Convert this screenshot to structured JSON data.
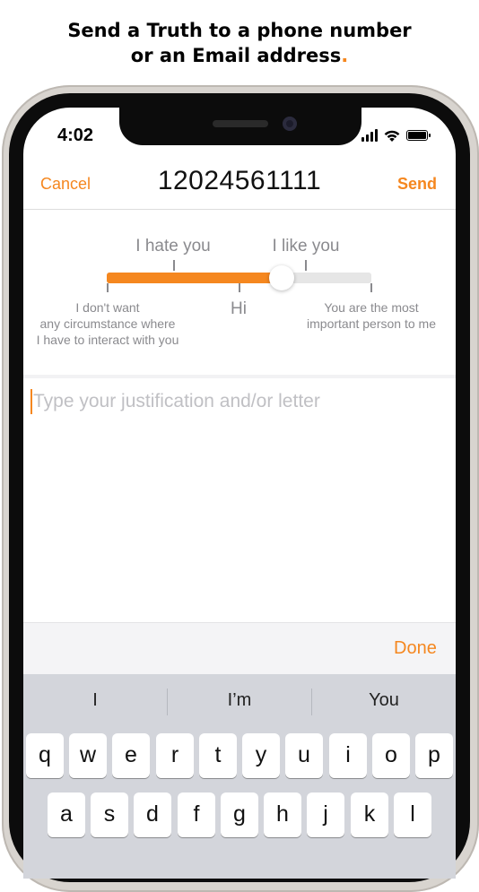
{
  "headline": {
    "line1": "Send a Truth to a phone number",
    "line2": "or an Email address",
    "dot": "."
  },
  "status": {
    "time": "4:02"
  },
  "nav": {
    "cancel": "Cancel",
    "title": "12024561111",
    "send": "Send"
  },
  "slider": {
    "top_left_label": "I hate you",
    "top_right_label": "I like you",
    "min_label_lines": [
      "I don't want",
      "any circumstance where",
      "I have to interact with you"
    ],
    "mid_label": "Hi",
    "max_label_lines": [
      "You are the most",
      "important person to me"
    ],
    "value_fraction": 0.66,
    "accent_color": "#f5871f"
  },
  "editor": {
    "placeholder": "Type your justification and/or letter"
  },
  "accessory": {
    "done": "Done"
  },
  "keyboard": {
    "suggestions": [
      "I",
      "I’m",
      "You"
    ],
    "row1": [
      "q",
      "w",
      "e",
      "r",
      "t",
      "y",
      "u",
      "i",
      "o",
      "p"
    ],
    "row2": [
      "a",
      "s",
      "d",
      "f",
      "g",
      "h",
      "j",
      "k",
      "l"
    ]
  },
  "icons": [
    "cellular-signal-icon",
    "wifi-icon",
    "battery-icon"
  ]
}
